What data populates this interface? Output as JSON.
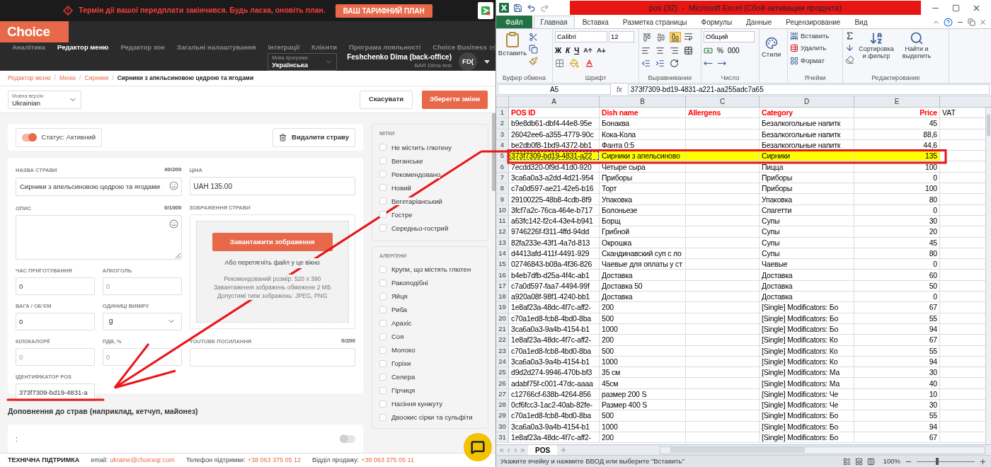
{
  "banner": {
    "message": "Термін дії вашої передплати закінчився. Будь ласка, оновіть план.",
    "button": "ВАШ ТАРИФНИЙ ПЛАН"
  },
  "app": {
    "logo": "Choice",
    "nav": [
      {
        "label": "Аналітика",
        "selected": false,
        "external": false
      },
      {
        "label": "Редактор меню",
        "selected": true,
        "external": false
      },
      {
        "label": "Редактор зон",
        "selected": false,
        "external": false
      },
      {
        "label": "Загальні налаштування",
        "selected": false,
        "external": false
      },
      {
        "label": "Інтеграції",
        "selected": false,
        "external": false
      },
      {
        "label": "Клієнти",
        "selected": false,
        "external": false
      },
      {
        "label": "Програма лояльності",
        "selected": false,
        "external": false
      },
      {
        "label": "Choice Business",
        "selected": false,
        "external": true
      }
    ],
    "program_language": {
      "label": "Мова програми:",
      "value": "Українська"
    },
    "user": {
      "name": "Feshchenko Dima (back-office)",
      "org": "BAR Dima test",
      "initials": "FD("
    }
  },
  "breadcrumb_separator": "/",
  "breadcrumb": [
    {
      "label": "Редактор меню",
      "current": false
    },
    {
      "label": "Меню",
      "current": false
    },
    {
      "label": "Сирники",
      "current": false
    },
    {
      "label": "Сирники з апельсиновою цедрою та ягодами",
      "current": true
    }
  ],
  "language_version": {
    "label": "Мовна версія:",
    "value": "Ukrainian"
  },
  "actions": {
    "cancel": "Скасувати",
    "save": "Зберегти зміни"
  },
  "status": {
    "label": "Статус: Активний",
    "on": true
  },
  "delete_button": "Видалити страву",
  "dish_name": {
    "label": "НАЗВА СТРАВИ",
    "counter": "40/200",
    "value": "Сирники з апельсиновою цедрою та ягодами"
  },
  "price": {
    "label": "ЦІНА",
    "value": "UAH 135.00"
  },
  "description": {
    "label": "ОПИС",
    "counter": "0/1000"
  },
  "small_fields": [
    {
      "label": "ЧАС ПРИГОТУВАННЯ",
      "kind": "input",
      "value": "0"
    },
    {
      "label": "АЛКОГОЛЬ",
      "kind": "input",
      "placeholder": "0"
    },
    {
      "label": "ВАГА / ОБ'ЄМ",
      "kind": "input",
      "value": "0"
    },
    {
      "label": "ОДИНИЦІ ВИМІРУ",
      "kind": "select",
      "value": "g"
    },
    {
      "label": "КІЛОКАЛОРІЇ",
      "kind": "input",
      "placeholder": "0"
    },
    {
      "label": "ПДВ, %",
      "kind": "input",
      "placeholder": "0"
    },
    {
      "label": "ІДЕНТИФІКАТОР POS",
      "kind": "input",
      "value": "373f7309-bd19-4831-a"
    }
  ],
  "image": {
    "label": "ЗОБРАЖЕННЯ СТРАВИ",
    "button": "Завантажити зображення",
    "hint": "Або перетягніть файл у це вікно",
    "notes": [
      "Рекомендований розмір: 520 x 390",
      "Завантаження зображень обмежене 2 МБ",
      "Допустимі типи зображень: JPEG, PNG"
    ]
  },
  "youtube": {
    "label": "YOUTUBE ПОСИЛАННЯ",
    "counter": "0/200"
  },
  "addons": {
    "title": "Доповнення до страв (наприклад, кетчуп, майонез)",
    "item": ":",
    "on": false
  },
  "tags": {
    "title": "МІТКИ",
    "items": [
      {
        "label": "Не містить глютену",
        "checked": false
      },
      {
        "label": "Веганське",
        "checked": false
      },
      {
        "label": "Рекомендовано",
        "checked": false
      },
      {
        "label": "Новий",
        "checked": false
      },
      {
        "label": "Вегетаріанський",
        "checked": false
      },
      {
        "label": "Гостре",
        "checked": false
      },
      {
        "label": "Середньо-гострий",
        "checked": false
      }
    ]
  },
  "allergens": {
    "title": "АЛЕРГЕНИ",
    "items": [
      {
        "label": "Крупи, що містять глютен",
        "checked": false
      },
      {
        "label": "Ракоподібні",
        "checked": false
      },
      {
        "label": "Яйця",
        "checked": false
      },
      {
        "label": "Риба",
        "checked": false
      },
      {
        "label": "Арахіс",
        "checked": false
      },
      {
        "label": "Соя",
        "checked": false
      },
      {
        "label": "Молоко",
        "checked": false
      },
      {
        "label": "Горіхи",
        "checked": false
      },
      {
        "label": "Селера",
        "checked": false
      },
      {
        "label": "Гірчиця",
        "checked": false
      },
      {
        "label": "Насіння кунжуту",
        "checked": false
      },
      {
        "label": "Двоокис сірки та сульфіти",
        "checked": false
      }
    ]
  },
  "footer": {
    "title": "ТЕХНІЧНА ПІДТРИМКА",
    "email_label": "email:",
    "email": "ukraine@choiceqr.com",
    "phone_label": "Телефон підтримки:",
    "phone": "+38 063 375 05 12",
    "sales_label": "Відділ продажу:",
    "sales_phone": "+38 063 375 05 11"
  },
  "excel": {
    "title": "pos (32)  -  Microsoft Excel (Сбой активации продукта)",
    "tabs": [
      {
        "label": "Файл",
        "kind": "file",
        "selected": false
      },
      {
        "label": "Главная",
        "kind": "tab",
        "selected": true
      },
      {
        "label": "Вставка",
        "kind": "tab",
        "selected": false
      },
      {
        "label": "Разметка страницы",
        "kind": "tab",
        "selected": false
      },
      {
        "label": "Формулы",
        "kind": "tab",
        "selected": false
      },
      {
        "label": "Данные",
        "kind": "tab",
        "selected": false
      },
      {
        "label": "Рецензирование",
        "kind": "tab",
        "selected": false
      },
      {
        "label": "Вид",
        "kind": "tab",
        "selected": false
      }
    ],
    "ribbon": {
      "clipboard": {
        "paste": "Вставить",
        "group": "Буфер обмена"
      },
      "font": {
        "name": "Calibri",
        "size": "12",
        "bold": "Ж",
        "italic": "К",
        "underline": "Ч",
        "group": "Шрифт"
      },
      "alignment": {
        "vertical_align_buttons": [
          {
            "selected": false
          },
          {
            "selected": false
          },
          {
            "selected": true
          }
        ],
        "group": "Выравнивание"
      },
      "number": {
        "format": "Общий",
        "percent": "%",
        "thousands": "000",
        "group": "Число"
      },
      "styles": {
        "label": "Стили"
      },
      "cells": {
        "insert": "Вставить",
        "delete": "Удалить",
        "format": "Формат",
        "group": "Ячейки"
      },
      "editing": {
        "sort": "Сортировка и фильтр",
        "find": "Найти и выделить",
        "group": "Редактирование"
      }
    },
    "name_box": "A5",
    "fx": "fx",
    "formula": "373f7309-bd19-4831-a221-aa255adc7a65",
    "columns": [
      "A",
      "B",
      "C",
      "D",
      "E"
    ],
    "header_row": "1",
    "header": [
      {
        "text": "POS ID",
        "color": "#ff0000"
      },
      {
        "text": "Dish name",
        "color": "#ff0000"
      },
      {
        "text": "Allergens",
        "color": "#ff0000"
      },
      {
        "text": "Category",
        "color": "#ff0000"
      },
      {
        "text": "Price",
        "color": "#ff0000"
      },
      {
        "text": "VAT",
        "color": "#000000"
      }
    ],
    "rows": [
      {
        "n": "2",
        "selected": false,
        "A": "b9e8db61-dbf4-44e8-95e",
        "B": "Бонаква",
        "D": "Безалкогольные напитк",
        "E": "45"
      },
      {
        "n": "3",
        "selected": false,
        "A": "26042ee6-a355-4779-90c",
        "B": "Кока-Кола",
        "D": "Безалкогольные напитк",
        "E": "88,6"
      },
      {
        "n": "4",
        "selected": false,
        "A": "be2db0f8-1bd9-4372-bb1",
        "B": "Фанта 0:5",
        "D": "Безалкогольные напитк",
        "E": "44,6"
      },
      {
        "n": "5",
        "selected": true,
        "A": "373f7309-bd19-4831-a22",
        "B": "Сирники з апельсиново",
        "D": "Сирники",
        "E": "135"
      },
      {
        "n": "6",
        "selected": false,
        "A": "7ecdd320-0f9d-41d0-920",
        "B": "Четыре сыра",
        "D": "Пицца",
        "E": "100"
      },
      {
        "n": "7",
        "selected": false,
        "A": "3ca6a0a3-a2dd-4d21-954",
        "B": "Приборы",
        "D": "Приборы",
        "E": "0"
      },
      {
        "n": "8",
        "selected": false,
        "A": "c7a0d597-ae21-42e5-b16",
        "B": "Торт",
        "D": "Приборы",
        "E": "100"
      },
      {
        "n": "9",
        "selected": false,
        "A": "29100225-48b8-4cdb-8f9",
        "B": "Упаковка",
        "D": "Упаковка",
        "E": "80"
      },
      {
        "n": "10",
        "selected": false,
        "A": "3fcf7a2c-76ca-464e-b717",
        "B": "Болоньезе",
        "D": "Спагетти",
        "E": "0"
      },
      {
        "n": "11",
        "selected": false,
        "A": "a63fc142-f2c4-43e4-b941",
        "B": "Борщ",
        "D": "Супы",
        "E": "30"
      },
      {
        "n": "12",
        "selected": false,
        "A": "9746226f-f311-4ffd-94dd",
        "B": "Грибной",
        "D": "Супы",
        "E": "20"
      },
      {
        "n": "13",
        "selected": false,
        "A": "82fa233e-43f1-4a7d-813",
        "B": "Окрошка",
        "D": "Супы",
        "E": "45"
      },
      {
        "n": "14",
        "selected": false,
        "A": "d4413afd-411f-4491-929",
        "B": "Скандинавский суп с ло",
        "D": "Супы",
        "E": "80"
      },
      {
        "n": "15",
        "selected": false,
        "A": "02746843-b08a-4f36-826",
        "B": "Чаевые для оплаты у ст",
        "D": "Чаевые",
        "E": "0"
      },
      {
        "n": "16",
        "selected": false,
        "A": "b4eb7dfb-d25a-4f4c-ab1",
        "B": "Доставка",
        "D": "Доставка",
        "E": "60"
      },
      {
        "n": "17",
        "selected": false,
        "A": "c7a0d597-faa7-4494-99f",
        "B": "Доставка 50",
        "D": "Доставка",
        "E": "50"
      },
      {
        "n": "18",
        "selected": false,
        "A": "a920a08f-98f1-4240-bb1",
        "B": "Доставка",
        "D": "Доставка",
        "E": "0"
      },
      {
        "n": "19",
        "selected": false,
        "A": "1e8af23a-48dc-4f7c-aff2-",
        "B": "200",
        "D": "[Single] Modificators: Бо",
        "E": "67"
      },
      {
        "n": "20",
        "selected": false,
        "A": "c70a1ed8-fcb8-4bd0-8ba",
        "B": "500",
        "D": "[Single] Modificators: Бо",
        "E": "55"
      },
      {
        "n": "21",
        "selected": false,
        "A": "3ca6a0a3-9a4b-4154-b1",
        "B": "1000",
        "D": "[Single] Modificators: Бо",
        "E": "94"
      },
      {
        "n": "22",
        "selected": false,
        "A": "1e8af23a-48dc-4f7c-aff2-",
        "B": "200",
        "D": "[Single] Modificators: Ко",
        "E": "67"
      },
      {
        "n": "23",
        "selected": false,
        "A": "c70a1ed8-fcb8-4bd0-8ba",
        "B": "500",
        "D": "[Single] Modificators: Ко",
        "E": "55"
      },
      {
        "n": "24",
        "selected": false,
        "A": "3ca6a0a3-9a4b-4154-b1",
        "B": "1000",
        "D": "[Single] Modificators: Ко",
        "E": "94"
      },
      {
        "n": "25",
        "selected": false,
        "A": "d9d2d274-9946-470b-bf3",
        "B": "35 см",
        "D": "[Single] Modificators: Ма",
        "E": "30"
      },
      {
        "n": "26",
        "selected": false,
        "A": "adabf75f-c001-47dc-aaaa",
        "B": "45см",
        "D": "[Single] Modificators: Ма",
        "E": "40"
      },
      {
        "n": "27",
        "selected": false,
        "A": "c12766cf-638b-4264-856",
        "B": "размер 200 S",
        "D": "[Single] Modificators: Че",
        "E": "10"
      },
      {
        "n": "28",
        "selected": false,
        "A": "0cf6fcc3-1ac2-40ab-82fe-",
        "B": "Размер 400 S",
        "D": "[Single] Modificators: Че",
        "E": "30"
      },
      {
        "n": "29",
        "selected": false,
        "A": "c70a1ed8-fcb8-4bd0-8ba",
        "B": "500",
        "D": "[Single] Modificators: Бо",
        "E": "55"
      },
      {
        "n": "30",
        "selected": false,
        "A": "3ca6a0a3-9a4b-4154-b1",
        "B": "1000",
        "D": "[Single] Modificators: Бо",
        "E": "94"
      },
      {
        "n": "31",
        "selected": false,
        "A": "1e8af23a-48dc-4f7c-aff2-",
        "B": "200",
        "D": "[Single] Modificators: Бо",
        "E": "67"
      }
    ],
    "sheet_tabs": [
      {
        "label": "POS",
        "selected": true
      }
    ],
    "status": "Укажите ячейку и нажмите ВВОД или выберите \"Вставить\"",
    "zoom": {
      "label": "100%",
      "level": 0.35
    }
  }
}
